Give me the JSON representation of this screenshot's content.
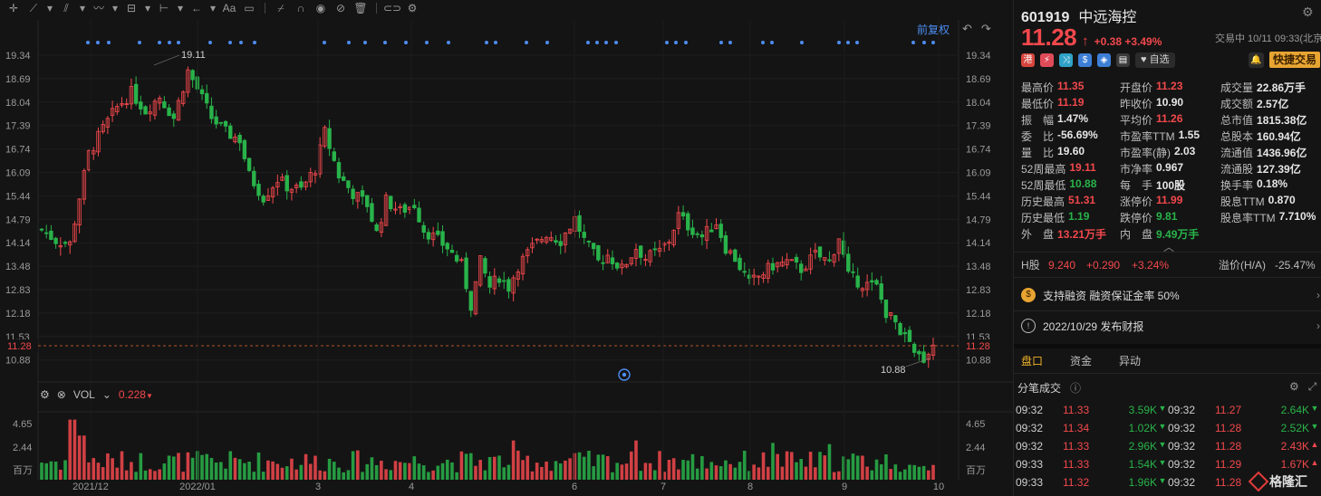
{
  "toolbar": {
    "icons": [
      "crosshair-icon",
      "line-tool-icon",
      "channel-tool-icon",
      "wave-tool-icon",
      "fib-tool-icon",
      "measure-tool-icon",
      "arrow-tool-icon",
      "text-tool-icon",
      "comment-tool-icon",
      "eraser-icon",
      "magnet-icon",
      "eye-icon",
      "hide-icon",
      "delete-icon",
      "toggle-icon",
      "settings-icon"
    ],
    "text_tool": "Aa"
  },
  "chart": {
    "price_ticks": [
      "19.34",
      "18.69",
      "18.04",
      "17.39",
      "16.74",
      "16.09",
      "15.44",
      "14.79",
      "14.14",
      "13.48",
      "12.83",
      "12.18",
      "11.53",
      "10.88"
    ],
    "current_price_label": "11.28",
    "high_marker": "19.11",
    "low_marker": "10.88",
    "adjust_label": "前复权",
    "date_labels": [
      "2021/12",
      "2022/01",
      "3",
      "4",
      "6",
      "7",
      "8",
      "9",
      "10"
    ],
    "vol_ticks": [
      "4.65",
      "2.44",
      "百万"
    ],
    "up_color": "#f2484c",
    "down_color": "#29b34a",
    "event_dot_color": "#4d8df2"
  },
  "volume": {
    "name": "VOL",
    "value": "0.228",
    "value_arrow": "▼"
  },
  "stock": {
    "code": "601919",
    "name": "中远海控",
    "price": "11.28",
    "change": "+0.38",
    "change_pct": "+3.49%",
    "status": "交易中 10/11 09:33(北京",
    "watch_label": "自选",
    "quick_trade": "快捷交易"
  },
  "quote": [
    [
      {
        "l": "最高价",
        "v": "11.35",
        "c": "red"
      },
      {
        "l": "开盘价",
        "v": "11.23",
        "c": "red"
      },
      {
        "l": "成交量",
        "v": "22.86万手",
        "c": "white"
      }
    ],
    [
      {
        "l": "最低价",
        "v": "11.19",
        "c": "red"
      },
      {
        "l": "昨收价",
        "v": "10.90",
        "c": "white"
      },
      {
        "l": "成交额",
        "v": "2.57亿",
        "c": "white"
      }
    ],
    [
      {
        "l": "振　幅",
        "v": "1.47%",
        "c": "white"
      },
      {
        "l": "平均价",
        "v": "11.26",
        "c": "red"
      },
      {
        "l": "总市值",
        "v": "1815.38亿",
        "c": "white"
      }
    ],
    [
      {
        "l": "委　比",
        "v": "-56.69%",
        "c": "white"
      },
      {
        "l": "市盈率TTM",
        "v": "1.55",
        "c": "white"
      },
      {
        "l": "总股本",
        "v": "160.94亿",
        "c": "white"
      }
    ],
    [
      {
        "l": "量　比",
        "v": "19.60",
        "c": "white"
      },
      {
        "l": "市盈率(静)",
        "v": "2.03",
        "c": "white"
      },
      {
        "l": "流通值",
        "v": "1436.96亿",
        "c": "white"
      }
    ],
    [
      {
        "l": "52周最高",
        "v": "19.11",
        "c": "red"
      },
      {
        "l": "市净率",
        "v": "0.967",
        "c": "white"
      },
      {
        "l": "流通股",
        "v": "127.39亿",
        "c": "white"
      }
    ],
    [
      {
        "l": "52周最低",
        "v": "10.88",
        "c": "green"
      },
      {
        "l": "每　手",
        "v": "100股",
        "c": "white"
      },
      {
        "l": "换手率",
        "v": "0.18%",
        "c": "white"
      }
    ],
    [
      {
        "l": "历史最高",
        "v": "51.31",
        "c": "red"
      },
      {
        "l": "涨停价",
        "v": "11.99",
        "c": "red"
      },
      {
        "l": "股息TTM",
        "v": "0.870",
        "c": "white"
      }
    ],
    [
      {
        "l": "历史最低",
        "v": "1.19",
        "c": "green"
      },
      {
        "l": "跌停价",
        "v": "9.81",
        "c": "green"
      },
      {
        "l": "股息率TTM",
        "v": "7.710%",
        "c": "white"
      }
    ],
    [
      {
        "l": "外　盘",
        "v": "13.21万手",
        "c": "red"
      },
      {
        "l": "内　盘",
        "v": "9.49万手",
        "c": "green"
      },
      {
        "l": "",
        "v": "",
        "c": "white"
      }
    ]
  ],
  "hshare": {
    "label": "H股",
    "price": "9.240",
    "change": "+0.290",
    "pct": "+3.24%",
    "premium_label": "溢价(H/A)",
    "premium": "-25.47%"
  },
  "info": {
    "margin": "支持融资 融资保证金率 50%",
    "report": "2022/10/29  发布财报"
  },
  "tabs": [
    "盘口",
    "资金",
    "异动"
  ],
  "ticks_title": "分笔成交",
  "ticks": [
    [
      {
        "t": "09:32",
        "p": "11.33",
        "v": "3.59K",
        "d": "down"
      },
      {
        "t": "09:32",
        "p": "11.27",
        "v": "2.64K",
        "d": "down"
      }
    ],
    [
      {
        "t": "09:32",
        "p": "11.34",
        "v": "1.02K",
        "d": "down"
      },
      {
        "t": "09:32",
        "p": "11.28",
        "v": "2.52K",
        "d": "down"
      }
    ],
    [
      {
        "t": "09:32",
        "p": "11.33",
        "v": "2.96K",
        "d": "down"
      },
      {
        "t": "09:32",
        "p": "11.28",
        "v": "2.43K",
        "d": "up"
      }
    ],
    [
      {
        "t": "09:33",
        "p": "11.33",
        "v": "1.54K",
        "d": "down"
      },
      {
        "t": "09:32",
        "p": "11.29",
        "v": "1.67K",
        "d": "up"
      }
    ],
    [
      {
        "t": "09:33",
        "p": "11.32",
        "v": "1.96K",
        "d": "down"
      },
      {
        "t": "09:32",
        "p": "11.28",
        "v": "",
        "d": ""
      }
    ]
  ],
  "logo_text": "格隆汇"
}
